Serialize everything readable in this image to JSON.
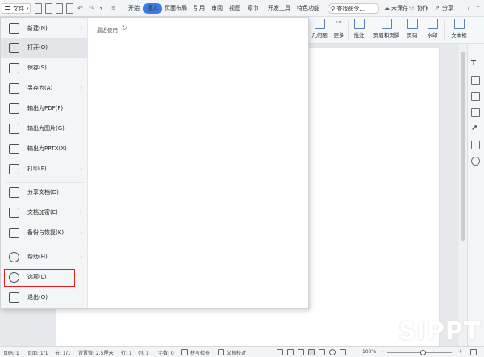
{
  "topbar": {
    "file_label": "文件",
    "tabs": [
      "开始",
      "插入",
      "页面布局",
      "引用",
      "审阅",
      "视图",
      "章节",
      "开发工具",
      "特色功能"
    ],
    "active_tab": "插入",
    "search_placeholder": "查找命令...",
    "right_actions": [
      "未保存",
      "协作",
      "分享"
    ]
  },
  "ribbon": {
    "items": [
      "几何图",
      "更多",
      "批注",
      "页眉和页脚",
      "页码",
      "水印",
      "文本框"
    ]
  },
  "filemenu": {
    "recent_title": "最近使用",
    "items": [
      {
        "label": "新建(N)",
        "icon": "new-doc-icon",
        "arrow": "›"
      },
      {
        "label": "打开(O)",
        "icon": "folder-open-icon",
        "arrow": ""
      },
      {
        "label": "保存(S)",
        "icon": "save-icon",
        "arrow": ""
      },
      {
        "label": "另存为(A)",
        "icon": "save-as-icon",
        "arrow": "›"
      },
      {
        "label": "输出为PDF(F)",
        "icon": "pdf-icon",
        "arrow": ""
      },
      {
        "label": "输出为图片(G)",
        "icon": "image-export-icon",
        "arrow": ""
      },
      {
        "label": "输出为PPTX(X)",
        "icon": "pptx-icon",
        "arrow": ""
      },
      {
        "label": "打印(P)",
        "icon": "print-icon",
        "arrow": "›"
      },
      {
        "label": "分享文档(D)",
        "icon": "share-icon",
        "arrow": ""
      },
      {
        "label": "文档加密(E)",
        "icon": "encrypt-icon",
        "arrow": "›"
      },
      {
        "label": "备份与恢复(K)",
        "icon": "backup-icon",
        "arrow": "›"
      },
      {
        "label": "帮助(H)",
        "icon": "help-icon",
        "arrow": "›"
      },
      {
        "label": "选项(L)",
        "icon": "gear-icon",
        "arrow": ""
      },
      {
        "label": "退出(Q)",
        "icon": "exit-icon",
        "arrow": ""
      }
    ]
  },
  "statusbar": {
    "page": "页码: 1",
    "pages": "页面: 1/1",
    "section": "节: 1/1",
    "setting": "设置值: 2.5厘米",
    "line": "行: 1",
    "col": "列: 1",
    "words": "字数: 0",
    "spellcheck": "拼写检查",
    "proofread": "文档校对",
    "zoom": "100%"
  },
  "watermark": "SIPPT",
  "colors": {
    "accent": "#3d7be4",
    "highlight_box": "#e21d1d"
  }
}
